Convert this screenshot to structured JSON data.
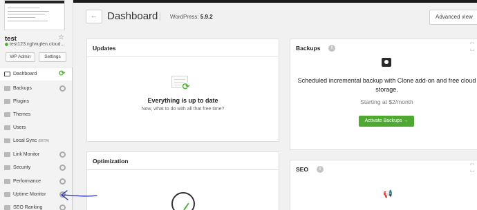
{
  "sidebar": {
    "site_name": "test",
    "site_url": "test123.ngfviujfen.cloud...",
    "wp_admin_label": "WP Admin",
    "settings_label": "Settings",
    "items": [
      {
        "label": "Dashboard",
        "icon": "monitor-icon"
      },
      {
        "label": "Backups",
        "icon": "backup-icon"
      },
      {
        "label": "Plugins",
        "icon": "plugin-icon"
      },
      {
        "label": "Themes",
        "icon": "theme-icon"
      },
      {
        "label": "Users",
        "icon": "users-icon"
      },
      {
        "label": "Local Sync",
        "badge": "(BETA)",
        "icon": "sync-icon"
      },
      {
        "label": "Link Monitor",
        "icon": "link-icon"
      },
      {
        "label": "Security",
        "icon": "shield-icon"
      },
      {
        "label": "Performance",
        "icon": "performance-icon"
      },
      {
        "label": "Uptime Monitor",
        "icon": "uptime-icon"
      },
      {
        "label": "SEO Ranking",
        "icon": "seo-icon"
      }
    ]
  },
  "header": {
    "back_glyph": "←",
    "title": "Dashboard",
    "wp_label": "WordPress:",
    "wp_version": "5.9.2",
    "advanced_view_label": "Advanced view"
  },
  "updates": {
    "title": "Updates",
    "headline": "Everything is up to date",
    "subtext": "Now, what to do with all that free time?"
  },
  "optimization": {
    "title": "Optimization"
  },
  "backups": {
    "title": "Backups",
    "message": "Scheduled incremental backup with Clone add-on and free cloud storage.",
    "price": "Starting at $2/month",
    "activate_label": "Activate Backups"
  },
  "seo": {
    "title": "SEO"
  },
  "colors": {
    "accent_green": "#4fa832",
    "annotation_blue": "#1f2bb5"
  }
}
